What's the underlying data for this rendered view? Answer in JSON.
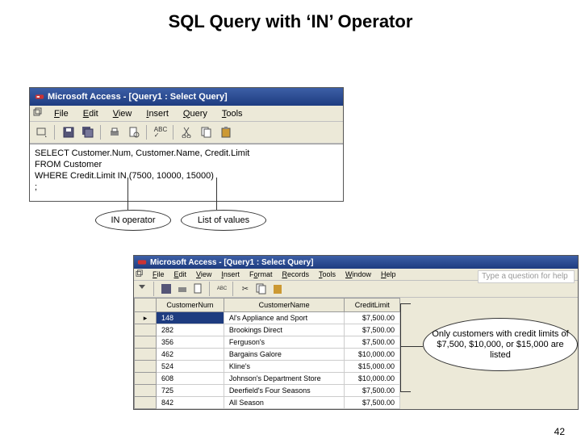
{
  "slide": {
    "title": "SQL Query with ‘IN’ Operator",
    "page_number": "42"
  },
  "sql_window": {
    "title": "Microsoft Access - [Query1 : Select Query]",
    "menus": {
      "file": "File",
      "edit": "Edit",
      "view": "View",
      "insert": "Insert",
      "query": "Query",
      "tools": "Tools"
    },
    "sql_line1": "SELECT Customer.Num, Customer.Name, Credit.Limit",
    "sql_line2": "FROM Customer",
    "sql_line3": "WHERE Credit.Limit IN (7500, 10000, 15000)",
    "sql_line4": ";"
  },
  "annotations": {
    "in_operator": "IN operator",
    "list_values": "List of values",
    "callout": "Only customers with credit limits of $7,500, $10,000, or $15,000 are listed"
  },
  "result_window": {
    "title": "Microsoft Access - [Query1 : Select Query]",
    "menus": {
      "file": "File",
      "edit": "Edit",
      "view": "View",
      "insert": "Insert",
      "format": "Format",
      "records": "Records",
      "tools": "Tools",
      "window": "Window",
      "help": "Help"
    },
    "help_placeholder": "Type a question for help",
    "columns": {
      "c1": "CustomerNum",
      "c2": "CustomerName",
      "c3": "CreditLimit"
    },
    "rows": [
      {
        "num": "148",
        "name": "Al's Appliance and Sport",
        "limit": "$7,500.00",
        "selected": true
      },
      {
        "num": "282",
        "name": "Brookings Direct",
        "limit": "$7,500.00"
      },
      {
        "num": "356",
        "name": "Ferguson's",
        "limit": "$7,500.00"
      },
      {
        "num": "462",
        "name": "Bargains Galore",
        "limit": "$10,000.00"
      },
      {
        "num": "524",
        "name": "Kline's",
        "limit": "$15,000.00"
      },
      {
        "num": "608",
        "name": "Johnson's Department Store",
        "limit": "$10,000.00"
      },
      {
        "num": "725",
        "name": "Deerfield's Four Seasons",
        "limit": "$7,500.00"
      },
      {
        "num": "842",
        "name": "All Season",
        "limit": "$7,500.00"
      }
    ]
  }
}
